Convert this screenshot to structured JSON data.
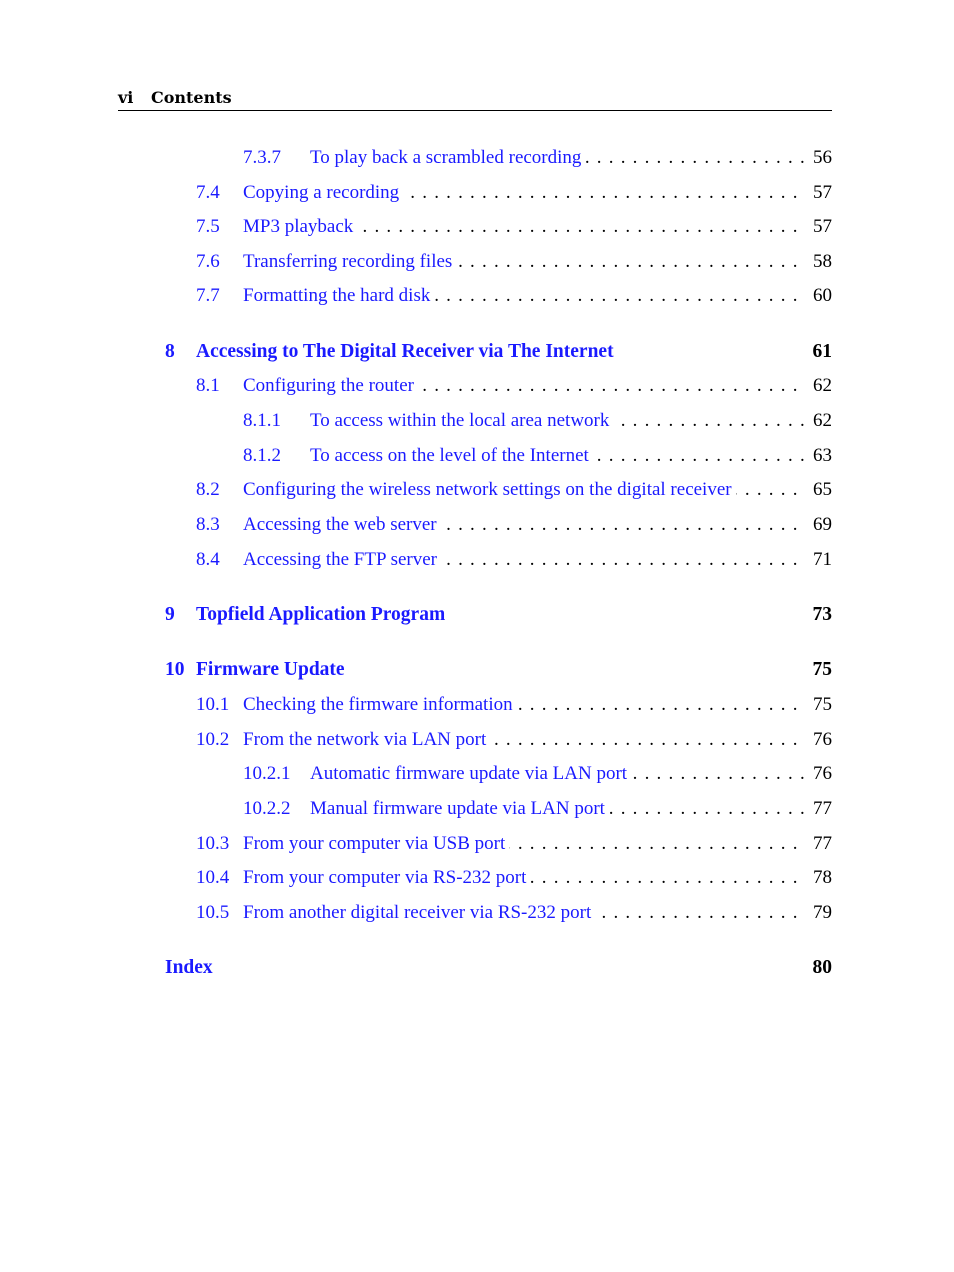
{
  "header": {
    "page_label": "vi",
    "title": "Contents"
  },
  "link_color": "#1a1aff",
  "entries": [
    {
      "level": 3,
      "number": "7.3.7",
      "title": "To play back a scrambled recording",
      "page": "56"
    },
    {
      "level": 2,
      "number": "7.4",
      "title": "Copying a recording",
      "page": "57"
    },
    {
      "level": 2,
      "number": "7.5",
      "title": "MP3 playback",
      "page": "57"
    },
    {
      "level": 2,
      "number": "7.6",
      "title": "Transferring recording files",
      "page": "58"
    },
    {
      "level": 2,
      "number": "7.7",
      "title": "Formatting the hard disk",
      "page": "60"
    },
    {
      "level": 1,
      "number": "8",
      "title": "Accessing to The Digital Receiver via The Internet",
      "page": "61"
    },
    {
      "level": 2,
      "number": "8.1",
      "title": "Configuring the router",
      "page": "62"
    },
    {
      "level": 3,
      "number": "8.1.1",
      "title": "To access within the local area network",
      "page": "62"
    },
    {
      "level": 3,
      "number": "8.1.2",
      "title": "To access on the level of the Internet",
      "page": "63"
    },
    {
      "level": 2,
      "number": "8.2",
      "title": "Configuring the wireless network settings on the digital receiver",
      "page": "65"
    },
    {
      "level": 2,
      "number": "8.3",
      "title": "Accessing the web server",
      "page": "69"
    },
    {
      "level": 2,
      "number": "8.4",
      "title": "Accessing the FTP server",
      "page": "71"
    },
    {
      "level": 1,
      "number": "9",
      "title": "Topfield Application Program",
      "page": "73"
    },
    {
      "level": 1,
      "number": "10",
      "title": "Firmware Update",
      "page": "75"
    },
    {
      "level": 2,
      "number": "10.1",
      "title": "Checking the firmware information",
      "page": "75"
    },
    {
      "level": 2,
      "number": "10.2",
      "title": "From the network via LAN port",
      "page": "76"
    },
    {
      "level": 3,
      "number": "10.2.1",
      "title": "Automatic firmware update via LAN port",
      "page": "76"
    },
    {
      "level": 3,
      "number": "10.2.2",
      "title": "Manual firmware update via LAN port",
      "page": "77"
    },
    {
      "level": 2,
      "number": "10.3",
      "title": "From your computer via USB port",
      "page": "77"
    },
    {
      "level": 2,
      "number": "10.4",
      "title": "From your computer via RS-232 port",
      "page": "78"
    },
    {
      "level": 2,
      "number": "10.5",
      "title": "From another digital receiver via RS-232 port",
      "page": "79"
    },
    {
      "level": 1,
      "number": "",
      "title": "Index",
      "page": "80"
    }
  ]
}
